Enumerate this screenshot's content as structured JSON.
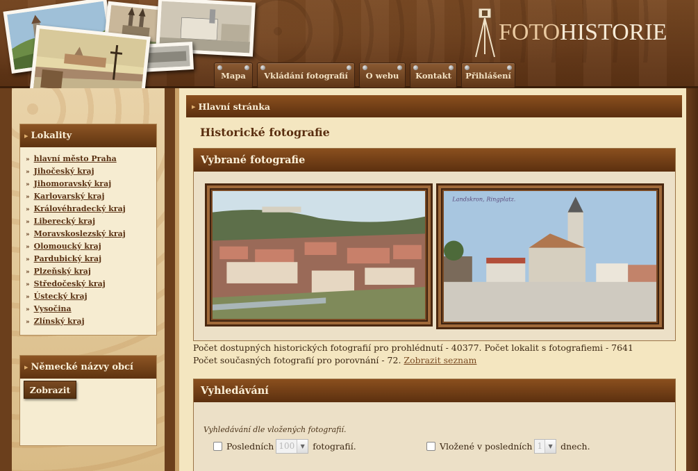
{
  "logo": {
    "part1": "FOTO",
    "part2": "HISTORIE"
  },
  "nav": [
    {
      "label": "Mapa"
    },
    {
      "label": "Vkládání fotografií"
    },
    {
      "label": "O webu"
    },
    {
      "label": "Kontakt"
    },
    {
      "label": "Přihlášení"
    }
  ],
  "breadcrumb": "Hlavní stránka",
  "page_title": "Historické fotografie",
  "sidebar": {
    "localities_title": "Lokality",
    "localities": [
      "hlavní město Praha",
      "Jihočeský kraj",
      "Jihomoravský kraj",
      "Karlovarský kraj",
      "Královéhradecký kraj",
      "Liberecký kraj",
      "Moravskoslezský kraj",
      "Olomoucký kraj",
      "Pardubický kraj",
      "Plzeňský kraj",
      "Středočeský kraj",
      "Ústecký kraj",
      "Vysočina",
      "Zlínský kraj"
    ],
    "german_names_title": "Německé názvy obcí",
    "show_button": "Zobrazit"
  },
  "featured": {
    "title": "Vybrané fotografie",
    "photo2_caption": "Landskron, Ringplatz."
  },
  "stats": {
    "line1": "Počet dostupných historických fotografií pro prohlédnutí - 40377. Počet lokalit s fotografiemi - 7641",
    "line2": "Počet současných fotografií pro porovnání - 72.",
    "link": "Zobrazit seznam"
  },
  "search": {
    "title": "Vyhledávání",
    "hint": "Vyhledávání dle vložených fotografií.",
    "last_label": "Posledních",
    "last_value": "100",
    "last_suffix": "fotografií.",
    "inserted_label": "Vložené v posledních",
    "inserted_value": "1",
    "inserted_suffix": "dnech."
  }
}
